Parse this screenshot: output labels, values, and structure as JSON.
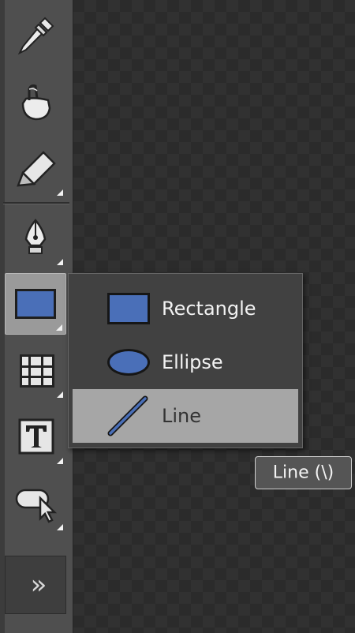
{
  "toolbar": {
    "tools": [
      {
        "name": "eyedropper-tool",
        "icon": "eyedropper-icon",
        "has_submenu": false
      },
      {
        "name": "paint-bucket-tool",
        "icon": "paint-bucket-icon",
        "has_submenu": false
      },
      {
        "name": "eraser-tool",
        "icon": "eraser-icon",
        "has_submenu": true
      },
      {
        "name": "pen-tool",
        "icon": "pen-nib-icon",
        "has_submenu": true
      },
      {
        "name": "shape-tool",
        "icon": "rectangle-icon",
        "has_submenu": true,
        "active": true
      },
      {
        "name": "table-tool",
        "icon": "table-grid-icon",
        "has_submenu": true
      },
      {
        "name": "text-tool",
        "icon": "text-t-icon",
        "has_submenu": true
      },
      {
        "name": "callout-tool",
        "icon": "callout-pointer-icon",
        "has_submenu": true
      }
    ],
    "expand_label": "»"
  },
  "flyout": {
    "items": [
      {
        "label": "Rectangle",
        "icon": "rectangle-icon",
        "selected": false
      },
      {
        "label": "Ellipse",
        "icon": "ellipse-icon",
        "selected": false
      },
      {
        "label": "Line",
        "icon": "line-icon",
        "selected": true
      }
    ]
  },
  "tooltip": {
    "text": "Line (\\)"
  },
  "colors": {
    "toolbar_bg": "#4f4f4f",
    "canvas_dark": "#2b2b2b",
    "canvas_light": "#313131",
    "shape_blue": "#4a6fb8",
    "menu_bg": "#414141",
    "menu_selected_bg": "#a6a6a6"
  }
}
